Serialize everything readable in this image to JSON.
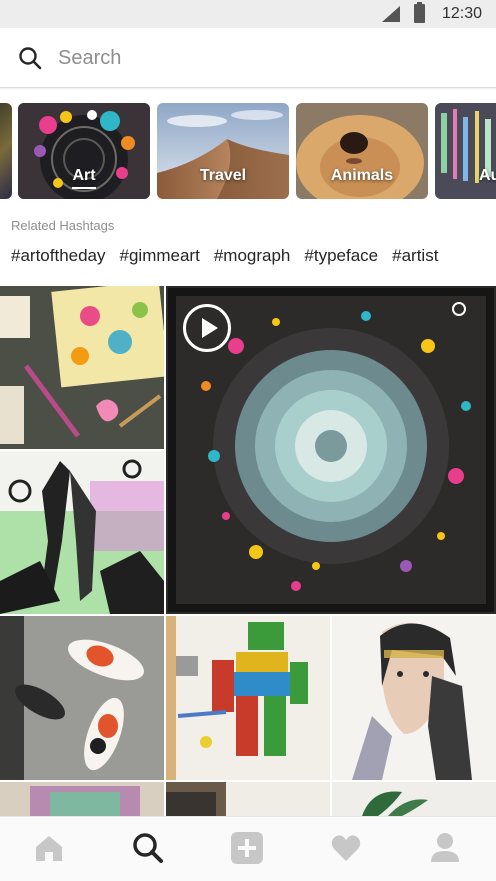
{
  "status_bar": {
    "time": "12:30"
  },
  "search": {
    "placeholder": "Search",
    "value": ""
  },
  "categories": [
    {
      "label": ""
    },
    {
      "label": "Art",
      "selected": true
    },
    {
      "label": "Travel"
    },
    {
      "label": "Animals"
    },
    {
      "label": "Au"
    }
  ],
  "related": {
    "title": "Related Hashtags",
    "tags": [
      "#artoftheday",
      "#gimmeart",
      "#mograph",
      "#typeface",
      "#artist"
    ]
  },
  "grid": {
    "items": [
      {
        "name": "art-supplies-photo",
        "type": "image"
      },
      {
        "name": "comic-illustration-photo",
        "type": "image"
      },
      {
        "name": "paint-splash-video",
        "type": "video"
      },
      {
        "name": "koi-fish-photo",
        "type": "image"
      },
      {
        "name": "robot-craft-photo",
        "type": "image"
      },
      {
        "name": "portrait-painting-photo",
        "type": "image"
      },
      {
        "name": "sketch-photo-partial",
        "type": "image"
      },
      {
        "name": "workbench-photo-partial",
        "type": "image"
      },
      {
        "name": "plant-drawing-partial",
        "type": "image"
      }
    ]
  },
  "tab_bar": {
    "tabs": [
      "home-icon",
      "search-icon",
      "add-icon",
      "heart-icon",
      "profile-icon"
    ],
    "active": "search-icon"
  },
  "colors": {
    "text": "#262626",
    "muted": "#8e8e8e",
    "status_bar": "#ededed",
    "tab_inactive": "#c7c7c7"
  }
}
